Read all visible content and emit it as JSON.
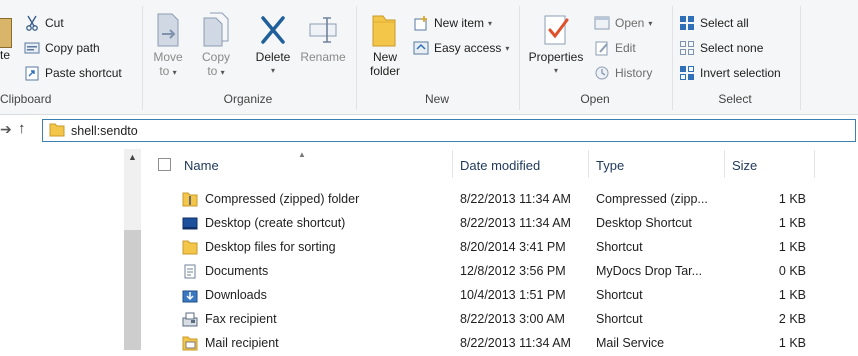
{
  "ribbon": {
    "clipboard": {
      "paste_label": "te",
      "cut": "Cut",
      "copy_path": "Copy path",
      "paste_shortcut": "Paste shortcut",
      "group": "Clipboard"
    },
    "organize": {
      "move_to": [
        "Move",
        "to"
      ],
      "copy_to": [
        "Copy",
        "to"
      ],
      "delete": "Delete",
      "rename": "Rename",
      "group": "Organize"
    },
    "new": {
      "new_folder": [
        "New",
        "folder"
      ],
      "new_item": "New item",
      "easy_access": "Easy access",
      "group": "New"
    },
    "open": {
      "properties": "Properties",
      "open": "Open",
      "edit": "Edit",
      "history": "History",
      "group": "Open"
    },
    "select": {
      "select_all": "Select all",
      "select_none": "Select none",
      "invert_selection": "Invert selection",
      "group": "Select"
    }
  },
  "address": {
    "path": "shell:sendto"
  },
  "columns": {
    "name": "Name",
    "date": "Date modified",
    "type": "Type",
    "size": "Size"
  },
  "files": [
    {
      "name": "Compressed (zipped) folder",
      "date": "8/22/2013 11:34 AM",
      "type": "Compressed (zipp...",
      "size": "1 KB",
      "icon": "zip-folder-icon"
    },
    {
      "name": "Desktop (create shortcut)",
      "date": "8/22/2013 11:34 AM",
      "type": "Desktop Shortcut",
      "size": "1 KB",
      "icon": "desktop-icon"
    },
    {
      "name": "Desktop files for sorting",
      "date": "8/20/2014 3:41 PM",
      "type": "Shortcut",
      "size": "1 KB",
      "icon": "folder-icon"
    },
    {
      "name": "Documents",
      "date": "12/8/2012 3:56 PM",
      "type": "MyDocs Drop Tar...",
      "size": "0 KB",
      "icon": "documents-icon"
    },
    {
      "name": "Downloads",
      "date": "10/4/2013 1:51 PM",
      "type": "Shortcut",
      "size": "1 KB",
      "icon": "downloads-icon"
    },
    {
      "name": "Fax recipient",
      "date": "8/22/2013 3:00 AM",
      "type": "Shortcut",
      "size": "2 KB",
      "icon": "fax-icon"
    },
    {
      "name": "Mail recipient",
      "date": "8/22/2013 11:34 AM",
      "type": "Mail Service",
      "size": "1 KB",
      "icon": "mail-icon"
    }
  ],
  "colors": {
    "accent": "#3c7fb1",
    "folder": "#f3c64a",
    "ribbon_bg": "#f5f6f7"
  }
}
